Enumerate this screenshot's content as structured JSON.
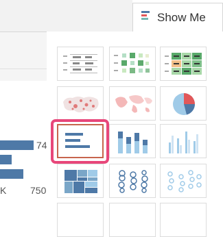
{
  "show_me": {
    "label": "Show Me",
    "icon": "show-me-icon"
  },
  "left_view": {
    "bar_label": "74",
    "axis_ticks": [
      "K",
      "750"
    ]
  },
  "chart_types": [
    {
      "name": "text-table",
      "selected": false
    },
    {
      "name": "heat-map",
      "selected": false
    },
    {
      "name": "highlight-table",
      "selected": false
    },
    {
      "name": "symbol-map",
      "selected": false
    },
    {
      "name": "filled-map",
      "selected": false
    },
    {
      "name": "pie-chart",
      "selected": false
    },
    {
      "name": "horizontal-bars",
      "selected": true
    },
    {
      "name": "stacked-bars",
      "selected": false
    },
    {
      "name": "side-by-side-bars",
      "selected": false
    },
    {
      "name": "treemap",
      "selected": false
    },
    {
      "name": "circle-views",
      "selected": false
    },
    {
      "name": "side-by-side-circles",
      "selected": false
    }
  ],
  "colors": {
    "accent_blue": "#4e79a7",
    "light_blue": "#a0cbe8",
    "selection_ring": "#e8477a",
    "selected_border": "#c7654d"
  }
}
